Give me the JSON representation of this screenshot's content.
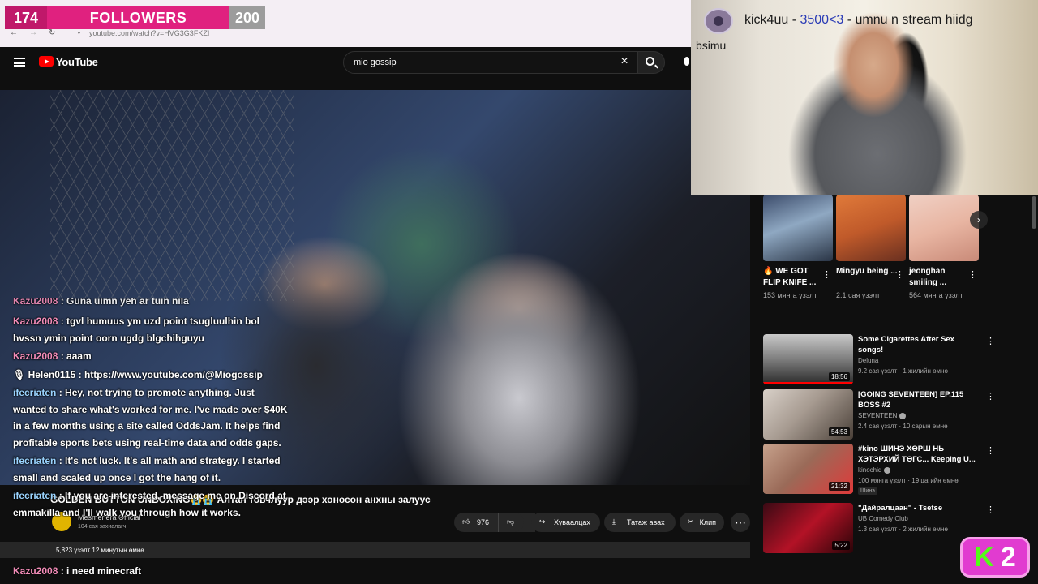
{
  "browser": {
    "url": "youtube.com/watch?v=HVG3G3FKZI"
  },
  "followers": {
    "current": "174",
    "label": "FOLLOWERS",
    "goal": "200"
  },
  "youtube": {
    "logo_text": "YouTube",
    "search_value": "mio gossip",
    "clear_glyph": "×"
  },
  "video": {
    "caption": "GOLDEN BUTTON UNBOXING😭😭 Алтан товчлуур дээр хоносон анхны залуус",
    "channel_name": "Mesmeriera Official",
    "subscribers": "104 сая захиалагч",
    "likes": "976",
    "share_label": "Хуваалцах",
    "download_label": "Татаж авах",
    "clip_label": "Клип",
    "more_glyph": "⋯",
    "info": "5,823 үзэлт  12 минутын өмнө"
  },
  "chat": {
    "messages": [
      {
        "user": "Kazu2008",
        "user_color": "pink",
        "text": " : Guna uimn yeh ar tuin nila"
      },
      {
        "user": "Kazu2008",
        "user_color": "pink",
        "text": " : tgvl humuus ym uzd point tsugluulhin bol hvssn ymin point oorn ugdg blgchihguyu"
      },
      {
        "user": "Kazu2008",
        "user_color": "pink",
        "text": " : aaam"
      },
      {
        "user": "🎙 Helen0115",
        "user_color": "white",
        "text": " : https://www.youtube.com/@Miogossip"
      },
      {
        "user": "ifecriaten",
        "user_color": "blue",
        "text": " : Hey, not trying to promote anything. Just wanted to share what's worked for me. I've made over $40K in a few months using a site called OddsJam. It helps find profitable sports bets using real-time data and odds gaps."
      },
      {
        "user": "ifecriaten",
        "user_color": "blue",
        "text": " : It's not luck. It's all math and strategy. I started small and scaled up once I got the hang of it."
      },
      {
        "user": "ifecriaten",
        "user_color": "blue",
        "text": " : If you are interested, message me on Discord at emmakilla and I'll walk you through how it works."
      }
    ],
    "last": {
      "user": "Kazu2008",
      "text": " : i need minecraft"
    }
  },
  "webcam": {
    "alert_user": "kick4uu",
    "alert_sep": " - ",
    "alert_amount": "3500<3",
    "alert_msg": " - umnu n stream hiidg",
    "sub_user": "bsimu"
  },
  "shorts": [
    {
      "title": "🔥 WE GOT FLIP KNIFE ...",
      "views": "153 мянга үзэлт"
    },
    {
      "title": "Mingyu being ...",
      "views": "2.1 сая үзэлт"
    },
    {
      "title": "jeonghan smiling ...",
      "views": "564 мянга үзэлт"
    }
  ],
  "shorts_next_glyph": "›",
  "videos": [
    {
      "title": "Some Cigarettes After Sex songs!",
      "channel": "Deluna",
      "meta": "9.2 сая үзэлт · 1 жилийн өмнө",
      "duration": "18:56",
      "verified": false,
      "tag": ""
    },
    {
      "title": "[GOING SEVENTEEN] EP.115 BOSS #2",
      "channel": "SEVENTEEN",
      "meta": "2.4 сая үзэлт · 10 сарын өмнө",
      "duration": "54:53",
      "verified": true,
      "tag": ""
    },
    {
      "title": "#kino ШИНЭ ХӨРШ НЬ ХЭТЭРХИЙ ТӨГС... Keeping U...",
      "channel": "kinochid",
      "meta": "100 мянга үзэлт · 19 цагийн өмнө",
      "duration": "21:32",
      "verified": true,
      "tag": "Шинэ"
    },
    {
      "title": "\"Дайралцаан\" - Tsetse",
      "channel": "UB Comedy Club",
      "meta": "1.3 сая үзэлт · 2 жилийн өмнө",
      "duration": "5:22",
      "verified": false,
      "tag": ""
    }
  ],
  "badge": {
    "k": "K",
    "num": "2"
  },
  "colors": {
    "accent_red": "#ff0000",
    "followers_pink": "#e0217f",
    "kick_green": "#53fc18",
    "badge_pink": "#e13bd0"
  }
}
